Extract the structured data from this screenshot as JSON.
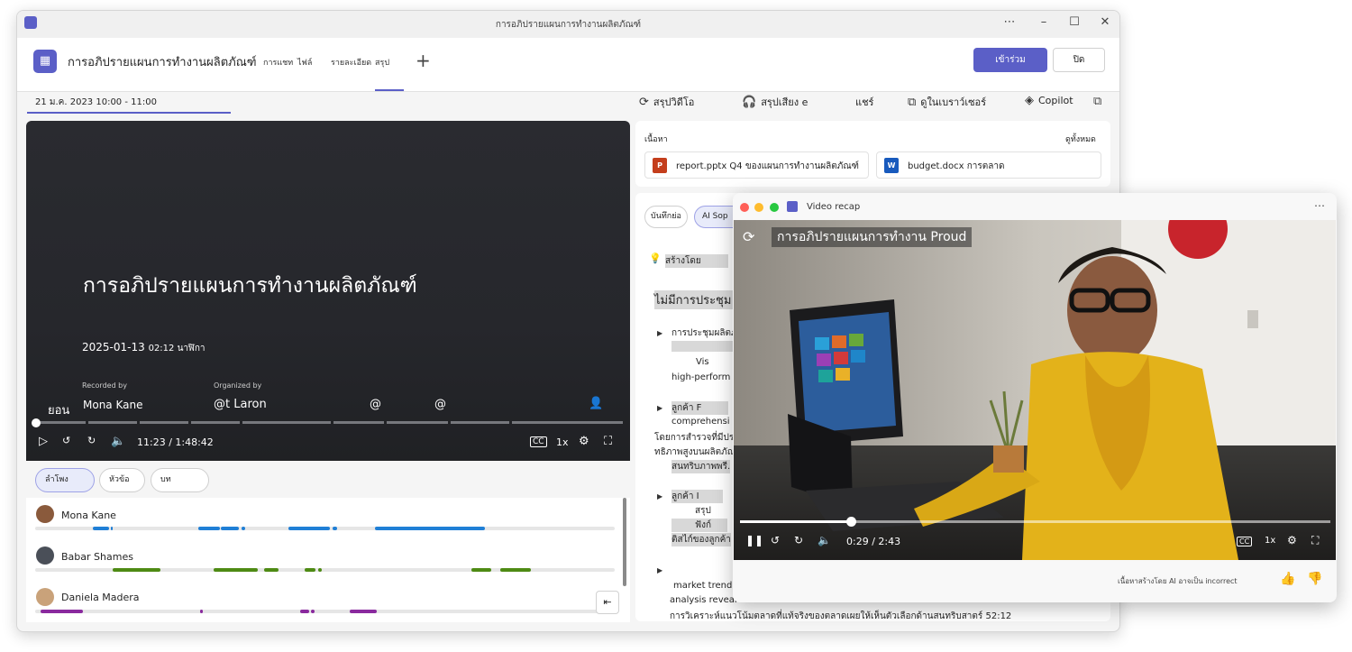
{
  "window": {
    "title": "การอภิปรายแผนการทำงานผลิตภัณฑ์"
  },
  "appbar": {
    "meeting_title": "การอภิปรายแผนการทำงานผลิตภัณฑ์",
    "tabs": [
      "การแชท",
      "ไฟล์",
      "รายละเอียด",
      "สรุป"
    ],
    "join_label": "เข้าร่วม",
    "close_label": "ปิด"
  },
  "date_range": "21 ม.ค. 2023 10:00 - 11:00",
  "actions": {
    "video_recap": "สรุปวิดีโอ",
    "audio_recap": "สรุปเสียง e",
    "share": "แชร์",
    "open_browser": "ดูในเบราว์เซอร์",
    "copilot": "Copilot"
  },
  "video": {
    "title": "การอภิปรายแผนการทำงานผลิตภัณฑ์",
    "date": "2025-01-13",
    "duration": "02:12 นาฬิกา",
    "recorded_by_label": "Recorded by",
    "organized_by_label": "Organized by",
    "left_label": "ยอน",
    "recorder": "Mona Kane",
    "organizer": "@t Laron",
    "at1": "@",
    "at2": "@",
    "time": "11:23 / 1:48:42",
    "speed": "1x"
  },
  "speaker_tabs": [
    "ลำโพง",
    "หัวข้อ",
    "บท"
  ],
  "speakers": [
    {
      "name": "Mona Kane",
      "color": "#1f7fd6"
    },
    {
      "name": "Babar Shames",
      "color": "#4e8a14"
    },
    {
      "name": "Daniela Madera",
      "color": "#8a2a9e"
    }
  ],
  "content": {
    "label": "เนื้อหา",
    "see_all": "ดูทั้งหมด",
    "files": [
      "report.pptx Q4 ของแผนการทำงานผลิตภัณฑ์",
      "budget.docx การตลาด"
    ]
  },
  "notes": {
    "tabs": [
      "บันทึกย่อ",
      "AI Sop"
    ],
    "generated_by": "สร้างโดย",
    "heading": "ไม่มีการประชุม",
    "items": [
      "การประชุมผลิตภัณฑ์",
      "Vis",
      "high-perform",
      "ลูกค้า F",
      "comprehensi",
      "โดยการสำรวจที่มีประสิ",
      "ทธิภาพสูงบนผลิตภัณฑ์",
      "สนทริบภาพพรี.",
      "ลูกค้า I",
      "สรุป",
      "ฟังก์",
      "ติสไก์ของลูกค้า",
      "market trend",
      "analysis reveal",
      "การวิเคราะห์แนวโน้มตลาดที่แท้จริงของตลาดเผยให้เห็นตัวเลือกด้านสนทริบสาตร์ 52:12"
    ]
  },
  "recap": {
    "window_title": "Video recap",
    "video_title": "การอภิปรายแผนการทำงาน Proud",
    "time": "0:29 / 2:43",
    "speed": "1x",
    "footer": "เนื้อหาสร้างโดย AI อาจเป็น incorrect"
  }
}
